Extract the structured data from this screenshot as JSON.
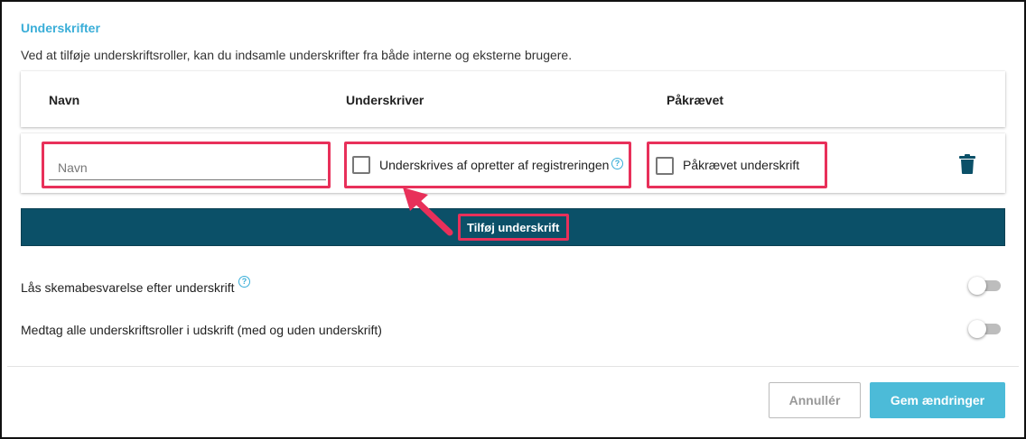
{
  "section": {
    "title": "Underskrifter",
    "description": "Ved at tilføje underskriftsroller, kan du indsamle underskrifter fra både interne og eksterne brugere."
  },
  "table": {
    "columns": [
      "Navn",
      "Underskriver",
      "Påkrævet"
    ],
    "row": {
      "name_placeholder": "Navn",
      "signer_checkbox_label": "Underskrives af opretter af registreringen",
      "required_checkbox_label": "Påkrævet underskrift"
    }
  },
  "add_button_label": "Tilføj underskrift",
  "options": [
    {
      "label": "Lås skemabesvarelse efter underskrift",
      "enabled": false
    },
    {
      "label": "Medtag alle underskriftsroller i udskrift (med og uden underskrift)",
      "enabled": false
    }
  ],
  "footer": {
    "cancel_label": "Annullér",
    "save_label": "Gem ændringer"
  },
  "colors": {
    "accent": "#3aaed8",
    "add_bar": "#0b5068",
    "highlight": "#e8305a",
    "save_button": "#4cbbd8"
  }
}
